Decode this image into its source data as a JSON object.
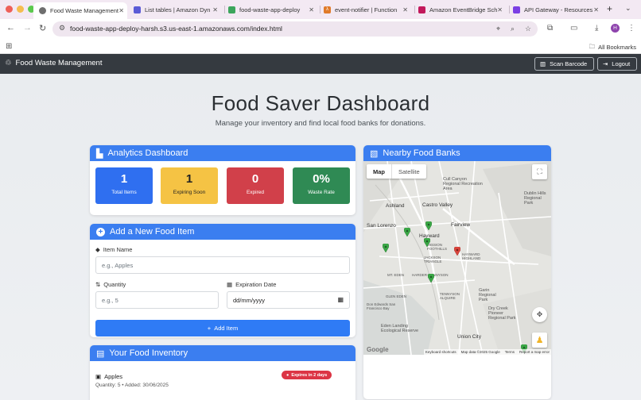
{
  "browser": {
    "tabs": [
      {
        "label": "Food Waste Management",
        "favicon_color": "#555555",
        "active": true
      },
      {
        "label": "List tables | Amazon Dyn",
        "favicon_color": "#5b5bd6"
      },
      {
        "label": "food-waste-app-deploy",
        "favicon_color": "#3ca55c"
      },
      {
        "label": "event-notifier | Function",
        "favicon_color": "#e07b2a"
      },
      {
        "label": "Amazon EventBridge Sch",
        "favicon_color": "#c2185b"
      },
      {
        "label": "API Gateway - Resources",
        "favicon_color": "#7b3fe4"
      }
    ],
    "url": "food-waste-app-deploy-harsh.s3.us-east-1.amazonaws.com/index.html",
    "profile_initial": "H",
    "all_bookmarks": "All Bookmarks"
  },
  "navbar": {
    "brand": "Food Waste Management",
    "scan_label": "Scan Barcode",
    "logout_label": "Logout"
  },
  "hero": {
    "title": "Food Saver Dashboard",
    "subtitle": "Manage your inventory and find local food banks for donations."
  },
  "analytics": {
    "header": "Analytics Dashboard",
    "stats": [
      {
        "value": "1",
        "label": "Total Items",
        "color": "#2f6ff0"
      },
      {
        "value": "1",
        "label": "Expiring Soon",
        "color": "#f5c344"
      },
      {
        "value": "0",
        "label": "Expired",
        "color": "#d1404a"
      },
      {
        "value": "0%",
        "label": "Waste Rate",
        "color": "#2f8a54"
      }
    ]
  },
  "add_item": {
    "header": "Add a New Food Item",
    "name_label": "Item Name",
    "name_placeholder": "e.g., Apples",
    "qty_label": "Quantity",
    "qty_placeholder": "e.g., 5",
    "date_label": "Expiration Date",
    "date_placeholder": "dd/mm/yyyy",
    "button_label": "Add Item"
  },
  "inventory": {
    "header": "Your Food Inventory",
    "items": [
      {
        "name": "Apples",
        "meta": "Quantity: 5 • Added: 30/06/2025",
        "badge": "Expires in 2 days"
      }
    ]
  },
  "food_banks": {
    "header": "Nearby Food Banks",
    "map_tab": "Map",
    "satellite_tab": "Satellite",
    "places": [
      "Cull Canyon Regional Recreation Area",
      "Dublin Hills Regional Park",
      "Ashland",
      "Castro Valley",
      "San Lorenzo",
      "Fairview",
      "Hayward",
      "MISSION FOOTHILLS",
      "HAYWARD HIGHLAND",
      "JACKSON TRIANGLE",
      "MT. EDEN",
      "HARDER-TENNYSON",
      "GLEN EDEN",
      "TENNYSON ALQUIRE",
      "Garin Regional Park",
      "Dry Creek Pioneer Regional Park",
      "Eden Landing Ecological Reserve",
      "Union City",
      "Don Edwards San Francisco Bay"
    ],
    "footer": [
      "Keyboard shortcuts",
      "Map data ©2025 Google",
      "Terms",
      "Report a map error"
    ],
    "google": "Google"
  }
}
